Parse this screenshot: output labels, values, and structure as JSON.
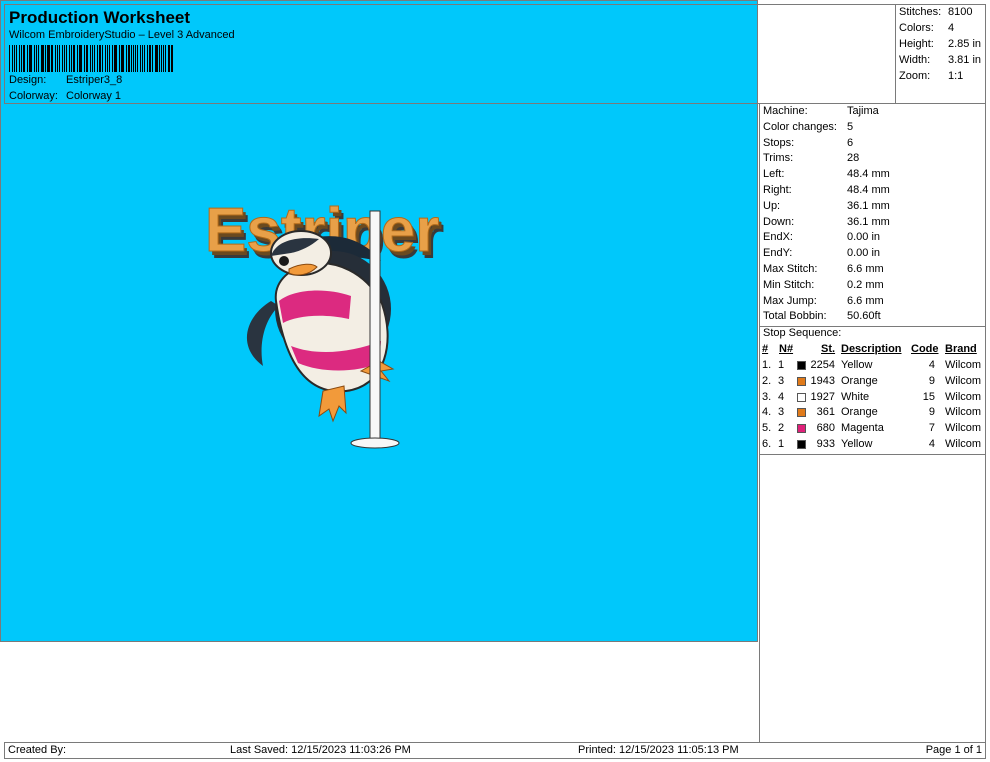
{
  "header": {
    "title": "Production Worksheet",
    "subtitle": "Wilcom EmbroideryStudio – Level 3 Advanced",
    "design_label": "Design:",
    "design_value": "Estriper3_8",
    "colorway_label": "Colorway:",
    "colorway_value": "Colorway 1"
  },
  "stats": [
    {
      "label": "Stitches:",
      "value": "8100"
    },
    {
      "label": "Colors:",
      "value": "4"
    },
    {
      "label": "Height:",
      "value": "2.85 in"
    },
    {
      "label": "Width:",
      "value": "3.81 in"
    },
    {
      "label": "Zoom:",
      "value": "1:1"
    }
  ],
  "machine_info": [
    {
      "label": "Machine:",
      "value": "Tajima"
    },
    {
      "label": "Color changes:",
      "value": "5"
    },
    {
      "label": "Stops:",
      "value": "6"
    },
    {
      "label": "Trims:",
      "value": "28"
    },
    {
      "label": "Left:",
      "value": "48.4 mm"
    },
    {
      "label": "Right:",
      "value": "48.4 mm"
    },
    {
      "label": "Up:",
      "value": "36.1 mm"
    },
    {
      "label": "Down:",
      "value": "36.1 mm"
    },
    {
      "label": "EndX:",
      "value": "0.00 in"
    },
    {
      "label": "EndY:",
      "value": "0.00 in"
    },
    {
      "label": "Max Stitch:",
      "value": "6.6 mm"
    },
    {
      "label": "Min Stitch:",
      "value": "0.2 mm"
    },
    {
      "label": "Max Jump:",
      "value": "6.6 mm"
    },
    {
      "label": "Total Bobbin:",
      "value": "50.60ft"
    }
  ],
  "stop_sequence": {
    "title": "Stop Sequence:",
    "headers": {
      "num": "#",
      "n": "N#",
      "st": "St.",
      "description": "Description",
      "code": "Code",
      "brand": "Brand"
    },
    "rows": [
      {
        "num": "1.",
        "n": "1",
        "color": "#000000",
        "st": "2254",
        "description": "Yellow",
        "code": "4",
        "brand": "Wilcom"
      },
      {
        "num": "2.",
        "n": "3",
        "color": "#e07a1a",
        "st": "1943",
        "description": "Orange",
        "code": "9",
        "brand": "Wilcom"
      },
      {
        "num": "3.",
        "n": "4",
        "color": "#ffffff",
        "st": "1927",
        "description": "White",
        "code": "15",
        "brand": "Wilcom"
      },
      {
        "num": "4.",
        "n": "3",
        "color": "#e07a1a",
        "st": "361",
        "description": "Orange",
        "code": "9",
        "brand": "Wilcom"
      },
      {
        "num": "5.",
        "n": "2",
        "color": "#e0207a",
        "st": "680",
        "description": "Magenta",
        "code": "7",
        "brand": "Wilcom"
      },
      {
        "num": "6.",
        "n": "1",
        "color": "#000000",
        "st": "933",
        "description": "Yellow",
        "code": "4",
        "brand": "Wilcom"
      }
    ]
  },
  "design_preview": {
    "text": "Estriper",
    "background_color": "#00c8fb"
  },
  "footer": {
    "created_by": "Created By:",
    "last_saved": "Last Saved: 12/15/2023 11:03:26 PM",
    "printed": "Printed: 12/15/2023 11:05:13 PM",
    "page": "Page 1 of 1"
  }
}
